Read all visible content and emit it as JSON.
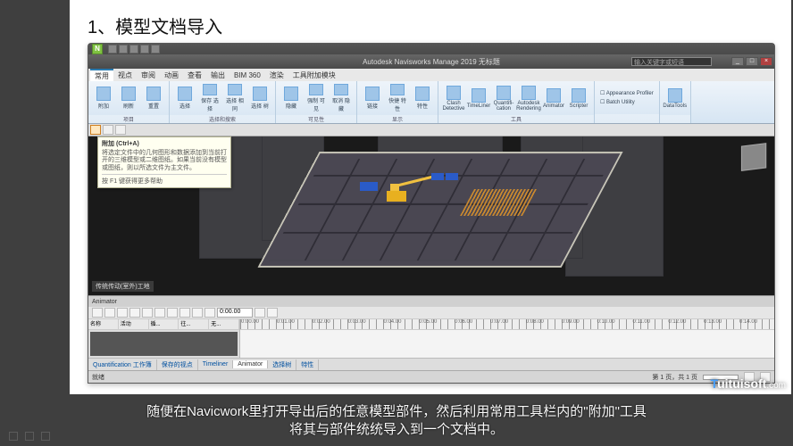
{
  "slide": {
    "title": "1、模型文档导入"
  },
  "window": {
    "title": "Autodesk Navisworks Manage 2019 无标题",
    "search_placeholder": "输入关键字或短语"
  },
  "menus": [
    "常用",
    "视点",
    "审阅",
    "动画",
    "查看",
    "输出",
    "BIM 360",
    "渲染",
    "工具附加模块"
  ],
  "active_menu_index": 0,
  "ribbon_groups": [
    {
      "label": "项目",
      "buttons": [
        {
          "name": "append",
          "label": "附加"
        },
        {
          "name": "refresh",
          "label": "刷新"
        },
        {
          "name": "reset",
          "label": "重置"
        }
      ]
    },
    {
      "label": "选择和搜索",
      "buttons": [
        {
          "name": "select",
          "label": "选择"
        },
        {
          "name": "save-selection",
          "label": "保存\n选择"
        },
        {
          "name": "select-same",
          "label": "选择\n相同"
        },
        {
          "name": "selection-tree",
          "label": "选择\n树"
        }
      ]
    },
    {
      "label": "可见性",
      "buttons": [
        {
          "name": "hide",
          "label": "隐藏"
        },
        {
          "name": "require",
          "label": "强制\n可见"
        },
        {
          "name": "unhide",
          "label": "取消\n隐藏"
        }
      ]
    },
    {
      "label": "显示",
      "buttons": [
        {
          "name": "links",
          "label": "链接"
        },
        {
          "name": "quick-props",
          "label": "快捷\n特性"
        },
        {
          "name": "properties",
          "label": "特性"
        }
      ]
    },
    {
      "label": "工具",
      "buttons": [
        {
          "name": "clash",
          "label": "Clash\nDetective"
        },
        {
          "name": "timeliner",
          "label": "TimeLiner"
        },
        {
          "name": "quant",
          "label": "Quantifi-\ncation"
        },
        {
          "name": "render",
          "label": "Autodesk\nRendering"
        },
        {
          "name": "animator",
          "label": "Animator"
        },
        {
          "name": "scripter",
          "label": "Scripter"
        }
      ]
    }
  ],
  "ribbon_checks": [
    "Appearance Profiler",
    "Batch Utility"
  ],
  "ribbon_tail": {
    "name": "datatools",
    "label": "DataTools"
  },
  "tooltip": {
    "title": "附加 (Ctrl+A)",
    "body": "将选定文件中的几何图形和数据添加到当前打开的三维模型或二维图纸。如果当前没有模型或图纸，则以所选文件为主文件。",
    "footer": "按 F1 键获得更多帮助"
  },
  "viewport": {
    "status_overlay": "传统传动(室外)工地"
  },
  "animator": {
    "title": "Animator",
    "time": "0:00.00",
    "columns": [
      "名称",
      "活动",
      "循...",
      "往...",
      "无..."
    ],
    "timeline_ticks": [
      "0:00.00",
      "0:01.00",
      "0:02.00",
      "0:03.00",
      "0:04.00",
      "0:05.00",
      "0:06.00",
      "0:07.00",
      "0:08.00",
      "0:09.00",
      "0:10.00",
      "0:11.00",
      "0:12.00",
      "0:13.00",
      "0:14.00"
    ]
  },
  "bottom_tabs": [
    "Quantification 工作簿",
    "保存的视点",
    "Timeliner",
    "Animator",
    "选择树",
    "特性"
  ],
  "active_bottom_tab": 3,
  "statusbar": {
    "left": "就绪",
    "right": "第 1 页，共 1 页"
  },
  "caption": "随便在Navicwork里打开导出后的任意模型部件，然后利用常用工具栏内的\"附加\"工具\n将其与部件统统导入到一个文档中。",
  "brand": {
    "lead": "T",
    "main": "uituisoft",
    "tld": ".com"
  }
}
